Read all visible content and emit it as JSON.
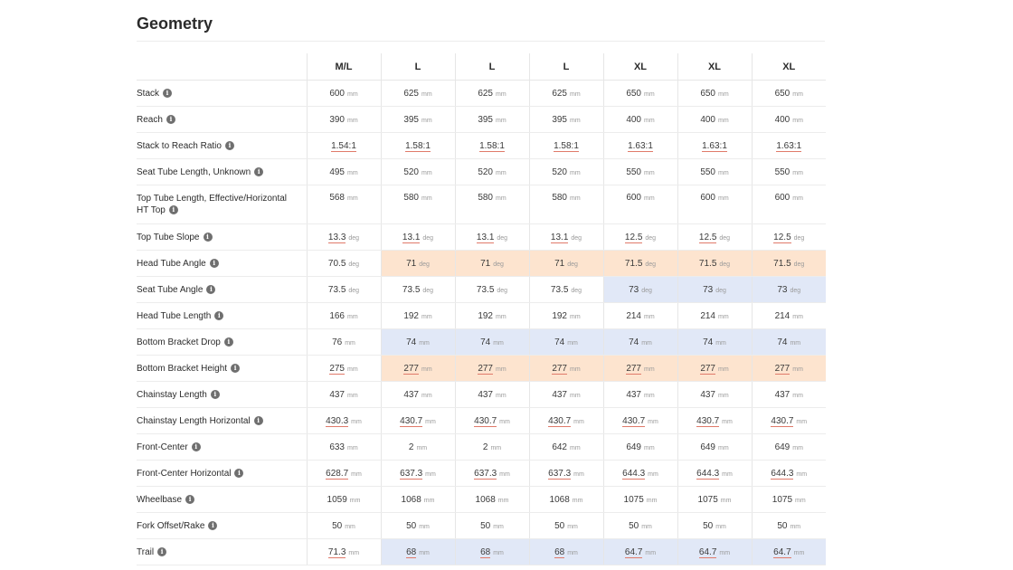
{
  "title": "Geometry",
  "info_glyph": "i",
  "sizes": [
    "M/L",
    "L",
    "L",
    "L",
    "XL",
    "XL",
    "XL"
  ],
  "rows": [
    {
      "label": "Stack",
      "unit": "mm",
      "values": [
        "600",
        "625",
        "625",
        "625",
        "650",
        "650",
        "650"
      ]
    },
    {
      "label": "Reach",
      "unit": "mm",
      "values": [
        "390",
        "395",
        "395",
        "395",
        "400",
        "400",
        "400"
      ]
    },
    {
      "label": "Stack to Reach Ratio",
      "unit": "",
      "underline": true,
      "values": [
        "1.54:1",
        "1.58:1",
        "1.58:1",
        "1.58:1",
        "1.63:1",
        "1.63:1",
        "1.63:1"
      ]
    },
    {
      "label": "Seat Tube Length, Unknown",
      "unit": "mm",
      "values": [
        "495",
        "520",
        "520",
        "520",
        "550",
        "550",
        "550"
      ]
    },
    {
      "label": "Top Tube Length, Effective/Horizontal HT Top",
      "unit": "mm",
      "tall": true,
      "values": [
        "568",
        "580",
        "580",
        "580",
        "600",
        "600",
        "600"
      ]
    },
    {
      "label": "Top Tube Slope",
      "unit": "deg",
      "underline": true,
      "values": [
        "13.3",
        "13.1",
        "13.1",
        "13.1",
        "12.5",
        "12.5",
        "12.5"
      ]
    },
    {
      "label": "Head Tube Angle",
      "unit": "deg",
      "highlight": [
        "",
        "orange",
        "orange",
        "orange",
        "orange",
        "orange",
        "orange"
      ],
      "values": [
        "70.5",
        "71",
        "71",
        "71",
        "71.5",
        "71.5",
        "71.5"
      ]
    },
    {
      "label": "Seat Tube Angle",
      "unit": "deg",
      "highlight": [
        "",
        "",
        "",
        "",
        "blue",
        "blue",
        "blue"
      ],
      "values": [
        "73.5",
        "73.5",
        "73.5",
        "73.5",
        "73",
        "73",
        "73"
      ]
    },
    {
      "label": "Head Tube Length",
      "unit": "mm",
      "values": [
        "166",
        "192",
        "192",
        "192",
        "214",
        "214",
        "214"
      ]
    },
    {
      "label": "Bottom Bracket Drop",
      "unit": "mm",
      "highlight": [
        "",
        "blue",
        "blue",
        "blue",
        "blue",
        "blue",
        "blue"
      ],
      "values": [
        "76",
        "74",
        "74",
        "74",
        "74",
        "74",
        "74"
      ]
    },
    {
      "label": "Bottom Bracket Height",
      "unit": "mm",
      "underline": true,
      "highlight": [
        "",
        "orange",
        "orange",
        "orange",
        "orange",
        "orange",
        "orange"
      ],
      "values": [
        "275",
        "277",
        "277",
        "277",
        "277",
        "277",
        "277"
      ]
    },
    {
      "label": "Chainstay Length",
      "unit": "mm",
      "values": [
        "437",
        "437",
        "437",
        "437",
        "437",
        "437",
        "437"
      ]
    },
    {
      "label": "Chainstay Length Horizontal",
      "unit": "mm",
      "underline": true,
      "values": [
        "430.3",
        "430.7",
        "430.7",
        "430.7",
        "430.7",
        "430.7",
        "430.7"
      ]
    },
    {
      "label": "Front-Center",
      "unit": "mm",
      "values": [
        "633",
        "2",
        "2",
        "642",
        "649",
        "649",
        "649"
      ]
    },
    {
      "label": "Front-Center Horizontal",
      "unit": "mm",
      "underline": true,
      "values": [
        "628.7",
        "637.3",
        "637.3",
        "637.3",
        "644.3",
        "644.3",
        "644.3"
      ]
    },
    {
      "label": "Wheelbase",
      "unit": "mm",
      "values": [
        "1059",
        "1068",
        "1068",
        "1068",
        "1075",
        "1075",
        "1075"
      ]
    },
    {
      "label": "Fork Offset/Rake",
      "unit": "mm",
      "values": [
        "50",
        "50",
        "50",
        "50",
        "50",
        "50",
        "50"
      ]
    },
    {
      "label": "Trail",
      "unit": "mm",
      "underline": true,
      "highlight": [
        "",
        "blue",
        "blue",
        "blue",
        "blue",
        "blue",
        "blue"
      ],
      "values": [
        "71.3",
        "68",
        "68",
        "68",
        "64.7",
        "64.7",
        "64.7"
      ]
    }
  ],
  "colors": {
    "orange_highlight": "#fde4cf",
    "blue_highlight": "#e1e8f7",
    "underline": "#e07a6a"
  }
}
